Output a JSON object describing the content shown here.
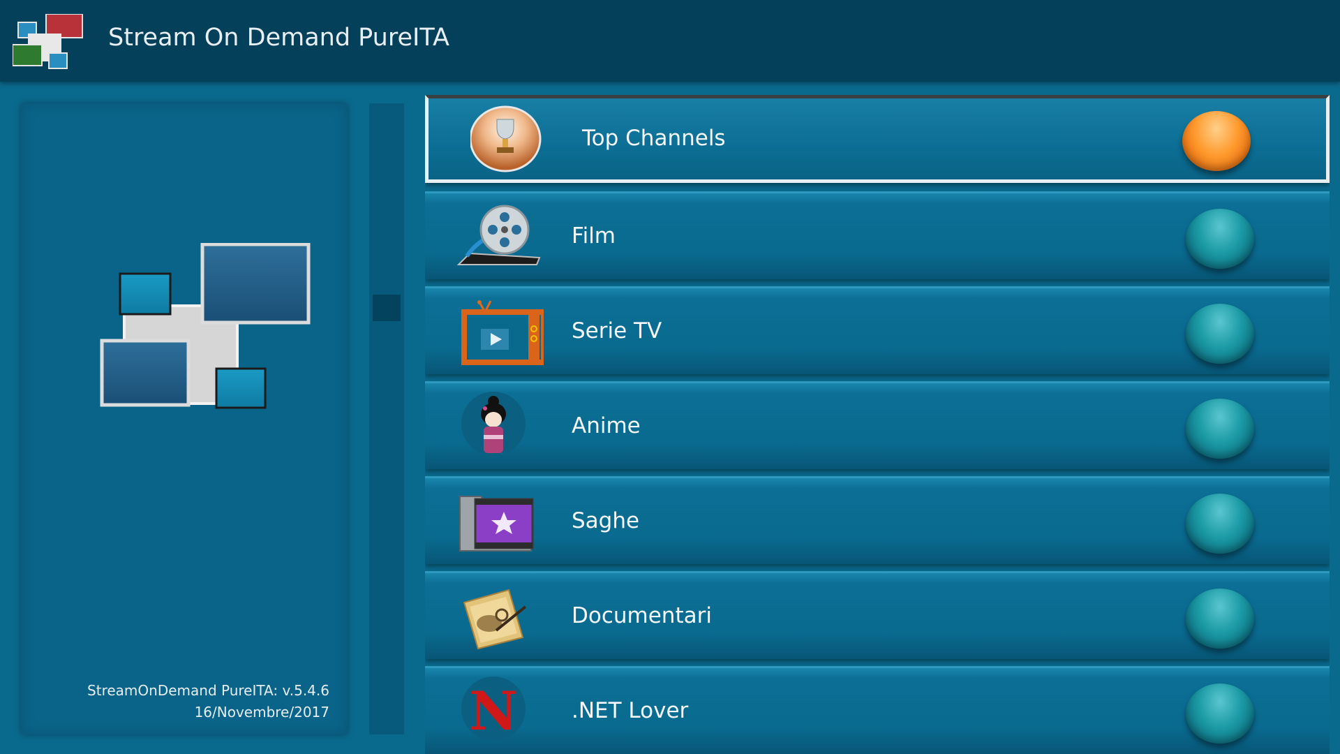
{
  "header": {
    "title": "Stream On Demand PureITA",
    "logo_icon": "app-logo-icon"
  },
  "left_panel": {
    "logo_icon": "app-logo-large-icon",
    "version_line1": "StreamOnDemand PureITA: v.5.4.6",
    "version_line2": "16/Novembre/2017"
  },
  "menu": {
    "items": [
      {
        "label": "Top Channels",
        "icon": "trophy-icon",
        "selected": true
      },
      {
        "label": "Film",
        "icon": "film-reel-icon",
        "selected": false
      },
      {
        "label": "Serie TV",
        "icon": "tv-icon",
        "selected": false
      },
      {
        "label": "Anime",
        "icon": "anime-doll-icon",
        "selected": false
      },
      {
        "label": "Saghe",
        "icon": "saga-folder-icon",
        "selected": false
      },
      {
        "label": "Documentari",
        "icon": "documentary-scroll-icon",
        "selected": false
      },
      {
        "label": ".NET Lover",
        "icon": "netlover-logo-icon",
        "selected": false
      }
    ]
  },
  "colors": {
    "background": "#0a6a8e",
    "header": "#05405a",
    "accent_active": "#ff9a2e",
    "accent_idle": "#1b9aa5"
  }
}
